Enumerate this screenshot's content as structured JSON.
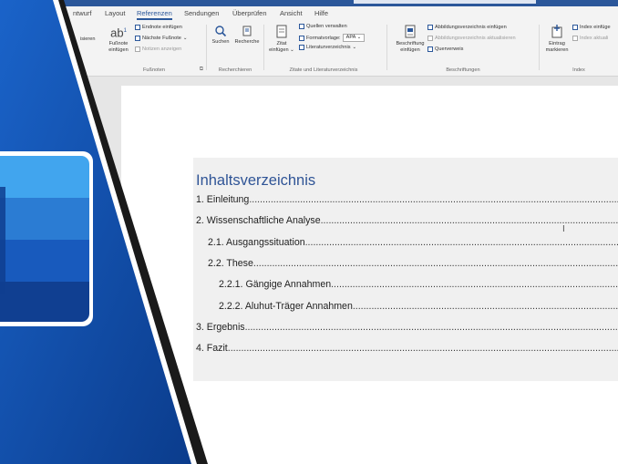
{
  "tabs": [
    "ntwurf",
    "Layout",
    "Referenzen",
    "Sendungen",
    "Überprüfen",
    "Ansicht",
    "Hilfe"
  ],
  "active_tab": "Referenzen",
  "ribbon": {
    "clipped_left": "isieren",
    "footnotes": {
      "insert_footnote": [
        "Fußnote",
        "einfügen"
      ],
      "insert_endnote": "Endnote einfügen",
      "next_footnote": "Nächste Fußnote",
      "show_notes": "Notizen anzeigen",
      "group_label": "Fußnoten"
    },
    "research": {
      "search": "Suchen",
      "researcher": "Recherche",
      "group_label": "Recherchieren"
    },
    "citations": {
      "insert_citation": [
        "Zitat",
        "einfügen"
      ],
      "manage_sources": "Quellen verwalten",
      "style_label": "Formatvorlage:",
      "style_value": "APA",
      "bibliography": "Literaturverzeichnis",
      "group_label": "Zitate und Literaturverzeichnis"
    },
    "captions": {
      "insert_caption": [
        "Beschriftung",
        "einfügen"
      ],
      "insert_table_of_figures": "Abbildungsverzeichnis einfügen",
      "update_table": "Abbildungsverzeichnis aktualisieren",
      "cross_reference": "Querverweis",
      "group_label": "Beschriftungen"
    },
    "index": {
      "mark_entry": [
        "Eintrag",
        "markieren"
      ],
      "insert_index": "Index einfüge",
      "update_index": "Index aktuali",
      "group_label": "Index"
    }
  },
  "toc": {
    "title": "Inhaltsverzeichnis",
    "entries": [
      {
        "text": "1. Einleitung",
        "level": 1
      },
      {
        "text": "2. Wissenschaftliche Analyse",
        "level": 1
      },
      {
        "text": "2.1. Ausgangssituation",
        "level": 2
      },
      {
        "text": "2.2. These",
        "level": 2
      },
      {
        "text": "2.2.1. Gängige Annahmen",
        "level": 3
      },
      {
        "text": "2.2.2. Aluhut-Träger Annahmen",
        "level": 3
      },
      {
        "text": "3. Ergebnis",
        "level": 1
      },
      {
        "text": "4. Fazit",
        "level": 1
      }
    ]
  },
  "colors": {
    "accent": "#2b579a",
    "heading": "#2f5496",
    "word_blue_1": "#41a5ee",
    "word_blue_2": "#2b7cd3",
    "word_blue_3": "#185abd",
    "word_blue_4": "#103f91"
  },
  "icons": [
    "word-logo-icon",
    "footnote-icon",
    "search-icon",
    "researcher-icon",
    "citation-icon",
    "caption-icon",
    "mark-entry-icon",
    "text-cursor-icon"
  ]
}
